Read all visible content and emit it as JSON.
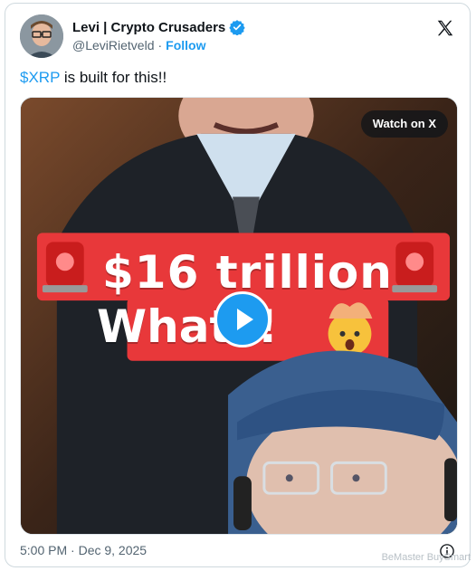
{
  "author": {
    "display_name": "Levi | Crypto Crusaders",
    "handle": "@LeviRietveld",
    "separator": "·",
    "follow_label": "Follow"
  },
  "tweet": {
    "cashtag": "$XRP",
    "text_rest": " is built for this!!"
  },
  "media": {
    "watch_label": "Watch on X",
    "banner_line1": "$16 trillion",
    "banner_line2": "What?!",
    "banner_color": "#e8383a"
  },
  "footer": {
    "timestamp": "5:00 PM · Dec 9, 2025"
  },
  "watermark": "BeMaster BuySmart",
  "colors": {
    "accent": "#1d9bf0",
    "text": "#0f1419",
    "muted": "#536471"
  }
}
